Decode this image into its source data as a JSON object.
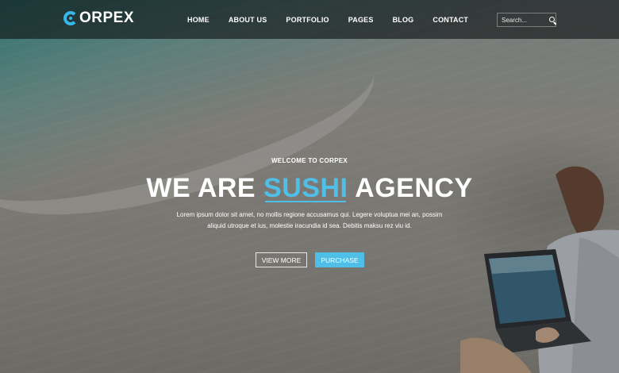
{
  "brand": {
    "logo_text": "ORPEX"
  },
  "nav": {
    "items": [
      "HOME",
      "ABOUT US",
      "PORTFOLIO",
      "PAGES",
      "BLOG",
      "CONTACT"
    ],
    "search_placeholder": "Search..."
  },
  "hero": {
    "kicker": "WELCOME TO CORPEX",
    "headline_prefix": "WE ARE ",
    "headline_accent": "SUSHI",
    "headline_suffix": " AGENCY",
    "description": "Lorem ipsum dolor sit amet, no mollis regione accusamus qui. Legere voluptua mei an, possim aliquid utroque et ius, molestie iracundia id sea. Debitis maksu rez viu id.",
    "button_primary": "VIEW MORE",
    "button_secondary": "PURCHASE"
  },
  "colors": {
    "accent": "#4fbfe8",
    "nav_bg": "#0f1214"
  }
}
